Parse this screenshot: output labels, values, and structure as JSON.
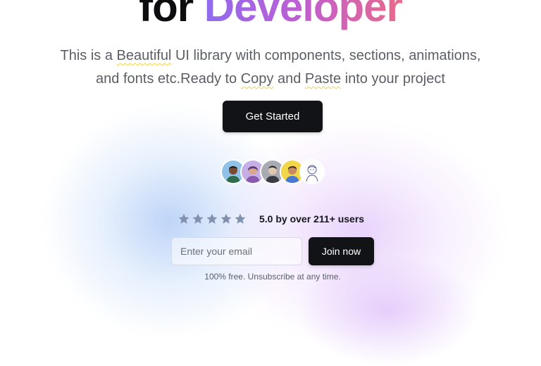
{
  "hero": {
    "headline_plain": "for ",
    "headline_gradient": "Developer",
    "subtitle": {
      "part1": "This is a ",
      "mark1": "Beautiful",
      "part2": " UI library with components, sections, animations,",
      "part3": "and fonts etc.Ready to ",
      "mark2": "Copy",
      "part4": " and ",
      "mark3": "Paste",
      "part5": " into your project"
    },
    "cta_label": "Get Started"
  },
  "social_proof": {
    "avatars": [
      "avatar-1",
      "avatar-2",
      "avatar-3",
      "avatar-4",
      "avatar-5"
    ],
    "stars": 5,
    "rating_text": "5.0 by over 211+ users"
  },
  "signup": {
    "email_placeholder": "Enter your email",
    "email_value": "",
    "join_label": "Join now",
    "note": "100% free. Unsubscribe at any time."
  },
  "colors": {
    "button_bg": "#121316",
    "gradient_start": "#8f6bf0",
    "gradient_end": "#e96a8a",
    "star": "#8191ad",
    "squiggle": "#f3d33a"
  }
}
